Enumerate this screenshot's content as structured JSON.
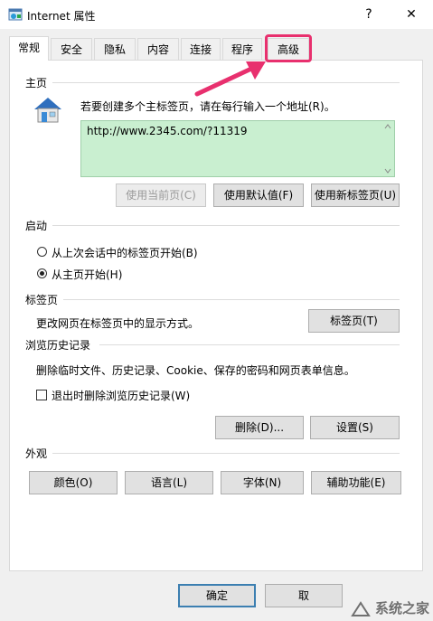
{
  "window": {
    "title": "Internet 属性",
    "help_glyph": "?",
    "close_glyph": "✕"
  },
  "tabs": [
    {
      "label": "常规",
      "active": true
    },
    {
      "label": "安全"
    },
    {
      "label": "隐私"
    },
    {
      "label": "内容"
    },
    {
      "label": "连接"
    },
    {
      "label": "程序"
    },
    {
      "label": "高级",
      "highlighted": true
    }
  ],
  "home_page": {
    "heading": "主页",
    "instruction": "若要创建多个主标签页，请在每行输入一个地址(R)。",
    "value": "http://www.2345.com/?11319",
    "buttons": {
      "use_current": "使用当前页(C)",
      "use_default": "使用默认值(F)",
      "use_new_tab": "使用新标签页(U)"
    }
  },
  "startup": {
    "heading": "启动",
    "options": [
      {
        "label": "从上次会话中的标签页开始(B)",
        "checked": false
      },
      {
        "label": "从主页开始(H)",
        "checked": true
      }
    ]
  },
  "tabs_section": {
    "heading": "标签页",
    "description": "更改网页在标签页中的显示方式。",
    "button": "标签页(T)"
  },
  "history": {
    "heading": "浏览历史记录",
    "description": "删除临时文件、历史记录、Cookie、保存的密码和网页表单信息。",
    "checkbox_label": "退出时删除浏览历史记录(W)",
    "checkbox_checked": false,
    "delete_button": "删除(D)...",
    "settings_button": "设置(S)"
  },
  "appearance": {
    "heading": "外观",
    "buttons": {
      "colors": "颜色(O)",
      "languages": "语言(L)",
      "fonts": "字体(N)",
      "accessibility": "辅助功能(E)"
    }
  },
  "footer": {
    "ok": "确定",
    "cancel": "取"
  },
  "watermark": "系统之家",
  "colors": {
    "highlight": "#e8306e",
    "textarea_bg": "#c9efd0"
  },
  "icons": {
    "app": "ie-settings-icon",
    "home": "home-house-icon",
    "arrow": "pink-arrow-annotation"
  }
}
